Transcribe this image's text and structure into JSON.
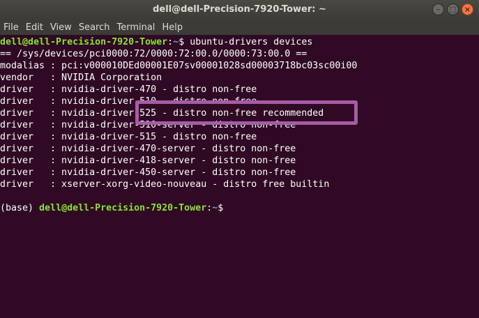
{
  "window": {
    "title": "dell@dell-Precision-7920-Tower: ~",
    "controls": {
      "minimize": "–",
      "maximize": "□",
      "close": "×"
    }
  },
  "menu": [
    "File",
    "Edit",
    "View",
    "Search",
    "Terminal",
    "Help"
  ],
  "terminal": {
    "prompt1": {
      "prefix": "",
      "user": "dell@dell-Precision-7920-Tower",
      "sep": ":",
      "path": "~",
      "symbol": "$",
      "command": " ubuntu-drivers devices"
    },
    "output": [
      "== /sys/devices/pci0000:72/0000:72:00.0/0000:73:00.0 ==",
      "modalias : pci:v000010DEd00001E07sv00001028sd00003718bc03sc00i00",
      "vendor   : NVIDIA Corporation",
      "driver   : nvidia-driver-470 - distro non-free",
      "driver   : nvidia-driver-510 - distro non-free",
      "driver   : nvidia-driver-525 - distro non-free recommended",
      "driver   : nvidia-driver-510-server - distro non-free",
      "driver   : nvidia-driver-515 - distro non-free",
      "driver   : nvidia-driver-470-server - distro non-free",
      "driver   : nvidia-driver-418-server - distro non-free",
      "driver   : nvidia-driver-450-server - distro non-free",
      "driver   : xserver-xorg-video-nouveau - distro free builtin"
    ],
    "blank": "",
    "prompt2": {
      "prefix": "(base) ",
      "user": "dell@dell-Precision-7920-Tower",
      "sep": ":",
      "path": "~",
      "symbol": "$",
      "command": ""
    }
  },
  "colors": {
    "background": "#300a24",
    "user": "#8ae234",
    "path": "#729fcf",
    "highlight": "#a65ba8"
  }
}
